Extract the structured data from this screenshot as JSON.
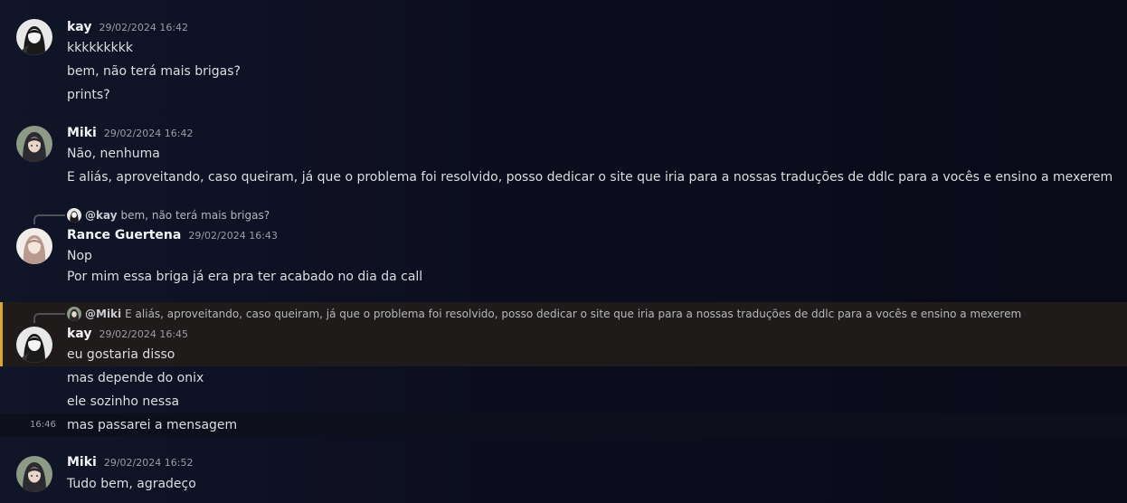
{
  "messages": [
    {
      "author": "kay",
      "timestamp": "29/02/2024 16:42",
      "lines": [
        "kkkkkkkkk",
        "bem, não terá mais brigas?",
        "prints?"
      ]
    },
    {
      "author": "Miki",
      "timestamp": "29/02/2024 16:42",
      "lines": [
        "Não, nenhuma",
        "E aliás, aproveitando, caso queiram, já que o problema foi resolvido, posso dedicar o site que iria para a nossas traduções de ddlc para a vocês e ensino a mexerem"
      ]
    },
    {
      "reply": {
        "user": "@kay",
        "text": "bem, não terá mais brigas?"
      },
      "author": "Rance Guertena",
      "timestamp": "29/02/2024 16:43",
      "lines": [
        "Nop",
        "Por mim essa briga já era pra ter acabado no dia da call"
      ]
    },
    {
      "reply": {
        "user": "@Miki",
        "text": "E aliás, aproveitando, caso queiram, já que o problema foi resolvido, posso dedicar o site que iria para a nossas traduções de ddlc para a vocês e ensino a mexerem"
      },
      "author": "kay",
      "timestamp": "29/02/2024 16:45",
      "lines": [
        "eu gostaria disso",
        "mas depende do onix",
        "ele sozinho nessa",
        "mas passarei a mensagem"
      ],
      "side_time": "16:46"
    },
    {
      "author": "Miki",
      "timestamp": "29/02/2024 16:52",
      "lines": [
        "Tudo bem, agradeço"
      ]
    }
  ],
  "colors": {
    "highlight_bar": "#d6a72e",
    "highlight_bg": "#1f1b1a",
    "background": "#0c0e1f"
  }
}
